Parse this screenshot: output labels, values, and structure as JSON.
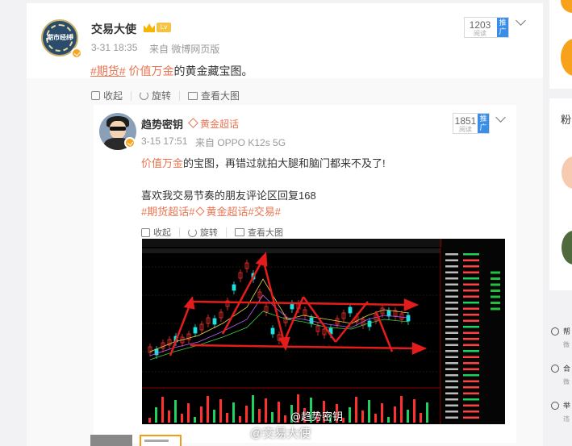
{
  "post": {
    "username": "交易大使",
    "level": "Lv",
    "timestamp": "3-31 18:35",
    "source": "来自 微博网页版",
    "text": {
      "tag": "#期货#",
      "highlight": "价值万金",
      "rest": "的黄金藏宝图。"
    },
    "read_count": "1203",
    "read_label": "阅读",
    "promo_label": "推广",
    "avatar_text": "期市经纬",
    "actions": {
      "collect": "收起",
      "rotate": "旋转",
      "view_large": "查看大图"
    }
  },
  "quoted": {
    "username": "趋势密钥",
    "topic": "黄金超话",
    "timestamp": "3-15 17:51",
    "source": "来自 OPPO K12s 5G",
    "read_count": "1851",
    "read_label": "阅读",
    "promo_label": "推广",
    "line1": {
      "highlight": "价值万金",
      "rest": "的宝图，再错过就拍大腿和脑门都来不及了!"
    },
    "line2": "喜欢我交易节奏的朋友评论区回复168",
    "line3": {
      "tag1": "#期货超话#",
      "tag2": "黄金超话#",
      "tag3": "交易#"
    },
    "actions": {
      "collect": "收起",
      "rotate": "旋转",
      "view_large": "查看大图"
    },
    "watermark_inner": "@趋势密钥",
    "watermark_outer": "@交易大使"
  },
  "sidebar": {
    "fans_label": "粉",
    "links": [
      {
        "label": "帮",
        "sub": "微"
      },
      {
        "label": "合",
        "sub": "微"
      },
      {
        "label": "举",
        "sub": "违"
      }
    ]
  },
  "colors": {
    "accent": "#eb7350",
    "promo": "#3a8ee6",
    "gold": "#f7a21a"
  }
}
